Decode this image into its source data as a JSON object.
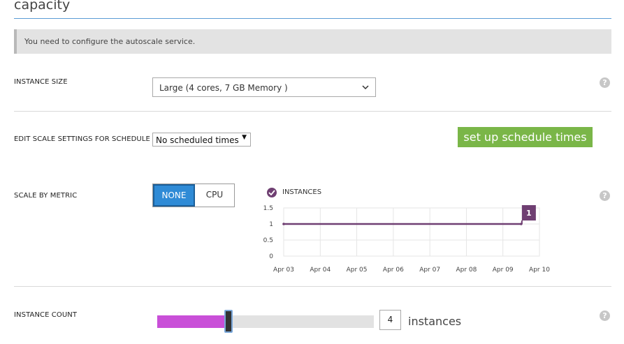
{
  "page": {
    "title": "capacity"
  },
  "notice": {
    "text": "You need to configure the autoscale service."
  },
  "instance_size": {
    "label": "INSTANCE SIZE",
    "selected": "Large (4 cores, 7 GB Memory )"
  },
  "schedule": {
    "label": "EDIT SCALE SETTINGS FOR SCHEDULE",
    "selected": "No scheduled times",
    "button_label": "set up schedule times"
  },
  "scale_by_metric": {
    "label": "SCALE BY METRIC",
    "options": [
      {
        "label": "NONE",
        "selected": true
      },
      {
        "label": "CPU",
        "selected": false
      }
    ]
  },
  "chart_data": {
    "type": "line",
    "series": [
      {
        "name": "INSTANCES",
        "x": [
          "Apr 03",
          "Apr 09 12:00"
        ],
        "values": [
          1,
          1
        ]
      }
    ],
    "x_ticks": [
      "Apr 03",
      "Apr 04",
      "Apr 05",
      "Apr 06",
      "Apr 07",
      "Apr 08",
      "Apr 09",
      "Apr 10"
    ],
    "y_ticks": [
      "1.5",
      "1",
      "0.5",
      "0"
    ],
    "ylim": [
      0,
      1.5
    ],
    "x_range": [
      0,
      7
    ],
    "end_point_x": 6.5,
    "end_label": "1",
    "grid": true,
    "legend": "top-left",
    "colors": {
      "series": "#6f3f72",
      "grid": "#e5e5e5"
    }
  },
  "instance_count": {
    "label": "INSTANCE COUNT",
    "value": "4",
    "unit": "instances",
    "slider_fraction": 0.33
  },
  "help_icon": "?",
  "colors": {
    "accent_blue": "#2f8bd6",
    "button_green": "#7ab648",
    "slider_fill": "#c94fd8"
  }
}
